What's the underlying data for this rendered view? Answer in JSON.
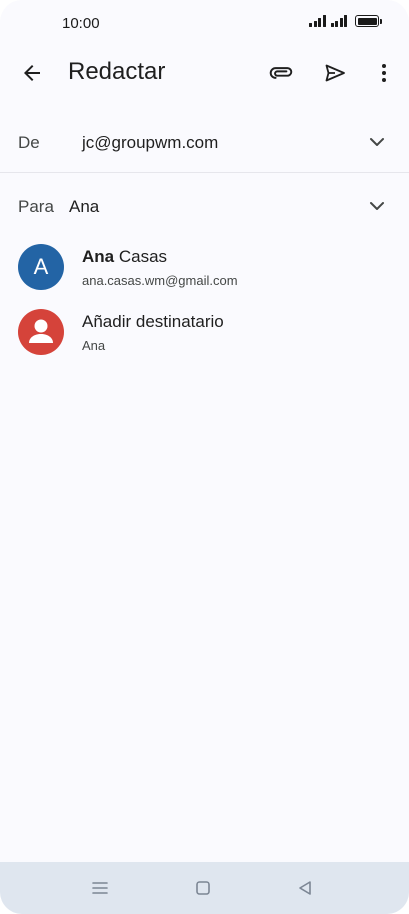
{
  "status_bar": {
    "time": "10:00"
  },
  "app_bar": {
    "title": "Redactar",
    "icons": [
      "arrow-back-icon",
      "paperclip-icon",
      "send-icon",
      "more-vert-icon"
    ]
  },
  "compose": {
    "from_label": "De",
    "from_value": "jc@groupwm.com",
    "to_label": "Para",
    "to_value": "Ana"
  },
  "suggestions": [
    {
      "avatar_letter": "A",
      "name_bold": "Ana",
      "name_rest": " Casas",
      "sub": "ana.casas.wm@gmail.com",
      "avatar_color": "#2364a5"
    },
    {
      "name": "Añadir destinatario",
      "sub": "Ana",
      "avatar_color": "#d5433a",
      "avatar_icon": "person-icon"
    }
  ],
  "nav_bar": {
    "icons": [
      "menu-icon",
      "home-icon",
      "back-triangle-icon"
    ]
  }
}
